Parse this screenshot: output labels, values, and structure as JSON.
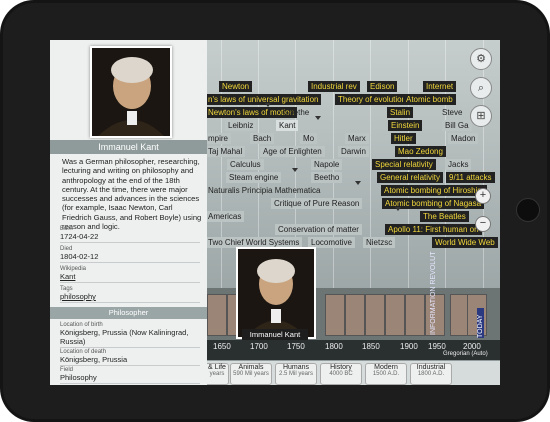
{
  "person": {
    "name": "Immanuel Kant",
    "description": "Was a German philosopher, researching, lecturing and writing on philosophy and anthropology at the end of the 18th century. At the time, there were major successes and advances in the sciences (for example, Isaac Newton, Carl Friedrich Gauss, and Robert Boyle) using reason and logic.",
    "role": "Philosopher",
    "fields": [
      {
        "label": "Born",
        "value": "1724-04-22"
      },
      {
        "label": "Died",
        "value": "1804-02-12"
      },
      {
        "label": "Wikipedia",
        "value": "Kant"
      },
      {
        "label": "Tags",
        "value": "philosophy"
      }
    ],
    "fields2": [
      {
        "label": "Location of birth",
        "value": "Königsberg, Prussia (Now Kaliningrad, Russia)"
      },
      {
        "label": "Location of death",
        "value": "Königsberg, Prussia"
      },
      {
        "label": "Field",
        "value": "Philosophy"
      }
    ]
  },
  "events": {
    "newton": "Newton",
    "industrial": "Industrial rev",
    "edison": "Edison",
    "internet": "Internet",
    "gravitation": "n's laws of universal gravitation",
    "evolution": "Theory of evolution",
    "atomic_bomb": "Atomic bomb",
    "newton_motion": "Newton's laws of motion",
    "goethe": "Goethe",
    "stalin": "Stalin",
    "steve": "Steve",
    "leibniz": "Leibniz",
    "kant": "Kant",
    "einstein": "Einstein",
    "bill_ga": "Bill Ga",
    "empire": "mpire",
    "bach": "Bach",
    "mo": "Mo",
    "marx": "Marx",
    "hitler": "Hitler",
    "madon": "Madon",
    "taj_mahal": "Taj Mahal",
    "enlightenment": "Age of Enlighten",
    "darwin": "Darwin",
    "mao": "Mao Zedong",
    "calculus": "Calculus",
    "napoleon": "Napole",
    "special_rel": "Special relativity",
    "jacks": "Jacks",
    "steam": "Steam engine",
    "beethoven": "Beetho",
    "general_rel": "General relativity",
    "attacks": "9/11 attacks",
    "principia": "Naturalis Principia Mathematica",
    "hiroshima": "Atomic bombing of Hiroshim",
    "pure_reason": "Critique of Pure Reason",
    "nagasaki": "Atomic bombing of Nagasa",
    "americas": "Americas",
    "beatles": "The Beatles",
    "conservation": "Conservation of matter",
    "apollo": "Apollo 11: First human on",
    "two_systems": "Two Chief World Systems",
    "locomotive": "Locomotive",
    "nietzsche": "Nietzsc",
    "www": "World Wide Web"
  },
  "side_labels": {
    "info_rev": "INFORMATION REVOLUT",
    "today": "TODAY"
  },
  "ruler": {
    "years": [
      "1650",
      "1700",
      "1750",
      "1800",
      "1850",
      "1900",
      "1950",
      "2000"
    ],
    "calendar": "Gregorian (Auto)"
  },
  "eras": [
    {
      "name": "& Life",
      "sub": "years"
    },
    {
      "name": "Animals",
      "sub": "590 Mil years"
    },
    {
      "name": "Humans",
      "sub": "2.5 Mil years"
    },
    {
      "name": "History",
      "sub": "4000 BC"
    },
    {
      "name": "Modern",
      "sub": "1500 A.D."
    },
    {
      "name": "Industrial",
      "sub": "1800 A.D."
    }
  ],
  "portrait_mid_label": "Immanuel Kant",
  "colors": {
    "highlight_text": "#f2d83b",
    "event_dark": "#222222",
    "panel_band": "#8f9a9a"
  }
}
